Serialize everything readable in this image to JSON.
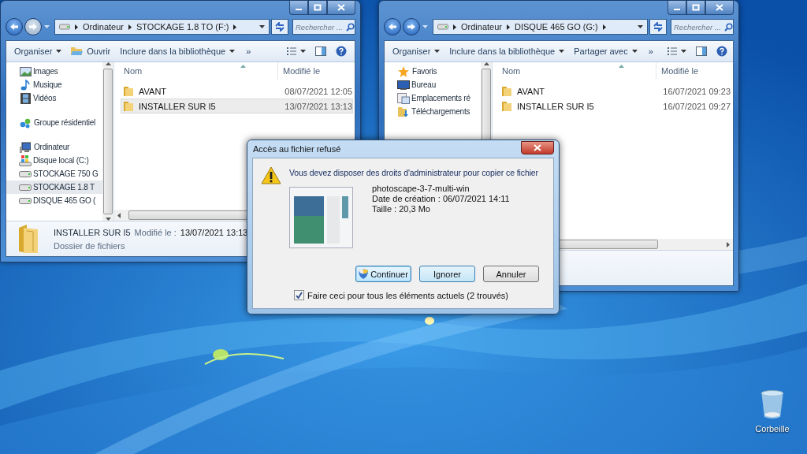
{
  "windows": [
    {
      "address": [
        "Ordinateur",
        "STOCKAGE 1.8 TO (F:)"
      ],
      "search": {
        "placeholder": "Rechercher ..."
      },
      "toolbar": [
        {
          "label": "Organiser",
          "kind": "menu"
        },
        {
          "label": "Ouvrir",
          "kind": "open"
        },
        {
          "label": "Inclure dans la bibliothèque",
          "kind": "menu"
        },
        {
          "label": "»",
          "kind": "more"
        }
      ],
      "nav": [
        {
          "items": [
            {
              "label": "Images",
              "kind": "pictures",
              "selected": false
            },
            {
              "label": "Musique",
              "kind": "music",
              "selected": false
            },
            {
              "label": "Vidéos",
              "kind": "video",
              "selected": false
            }
          ]
        },
        {
          "heading": {
            "label": "Groupe résidentiel",
            "kind": "homegroup"
          }
        },
        {
          "heading": {
            "label": "Ordinateur",
            "kind": "computer"
          },
          "items": [
            {
              "label": "Disque local (C:)",
              "kind": "system-drive",
              "selected": false
            },
            {
              "label": "STOCKAGE 750 G",
              "kind": "drive",
              "selected": false
            },
            {
              "label": "STOCKAGE 1.8 T",
              "kind": "drive",
              "selected": true
            },
            {
              "label": "DISQUE 465 GO (",
              "kind": "drive",
              "selected": false
            }
          ]
        }
      ],
      "columns": [
        "Nom",
        "Modifié le"
      ],
      "rows": [
        {
          "name": "AVANT",
          "modified": "08/07/2021 12:05",
          "selected": false
        },
        {
          "name": "INSTALLER SUR I5",
          "modified": "13/07/2021 13:13",
          "selected": true
        }
      ],
      "details": {
        "name": "INSTALLER SUR I5",
        "modified_label": "Modifié le :",
        "modified": "13/07/2021 13:13",
        "type": "Dossier de fichiers"
      }
    },
    {
      "address": [
        "Ordinateur",
        "DISQUE 465 GO (G:)"
      ],
      "search": {
        "placeholder": "Rechercher ..."
      },
      "toolbar": [
        {
          "label": "Organiser",
          "kind": "menu"
        },
        {
          "label": "Inclure dans la bibliothèque",
          "kind": "menu"
        },
        {
          "label": "Partager avec",
          "kind": "menu"
        },
        {
          "label": "»",
          "kind": "more"
        }
      ],
      "nav": [
        {
          "heading": {
            "label": "Favoris",
            "kind": "star"
          },
          "items": [
            {
              "label": "Bureau",
              "kind": "desktop",
              "selected": false
            },
            {
              "label": "Emplacements ré",
              "kind": "places",
              "selected": false
            },
            {
              "label": "Téléchargements",
              "kind": "downloads",
              "selected": false
            }
          ]
        }
      ],
      "columns": [
        "Nom",
        "Modifié le"
      ],
      "rows": [
        {
          "name": "AVANT",
          "modified": "16/07/2021 09:23",
          "selected": false
        },
        {
          "name": "INSTALLER SUR I5",
          "modified": "16/07/2021 09:27",
          "selected": false
        }
      ]
    }
  ],
  "dialog": {
    "title": "Accès au fichier refusé",
    "message": "Vous devez disposer des droits d'administrateur pour copier ce fichier",
    "file": [
      "photoscape-3-7-multi-win",
      "Date de création : 06/07/2021 14:11",
      "Taille : 20,3 Mo"
    ],
    "buttons": [
      {
        "label": "Continuer",
        "kind": "elevated"
      },
      {
        "label": "Ignorer",
        "kind": "focused"
      },
      {
        "label": "Annuler",
        "kind": "plain"
      }
    ],
    "apply_all": {
      "label": "Faire ceci pour tous les éléments actuels (2 trouvés)",
      "checked": true
    }
  },
  "desktop_icons": [
    {
      "label": "Corbeille",
      "kind": "recycle-bin"
    }
  ]
}
